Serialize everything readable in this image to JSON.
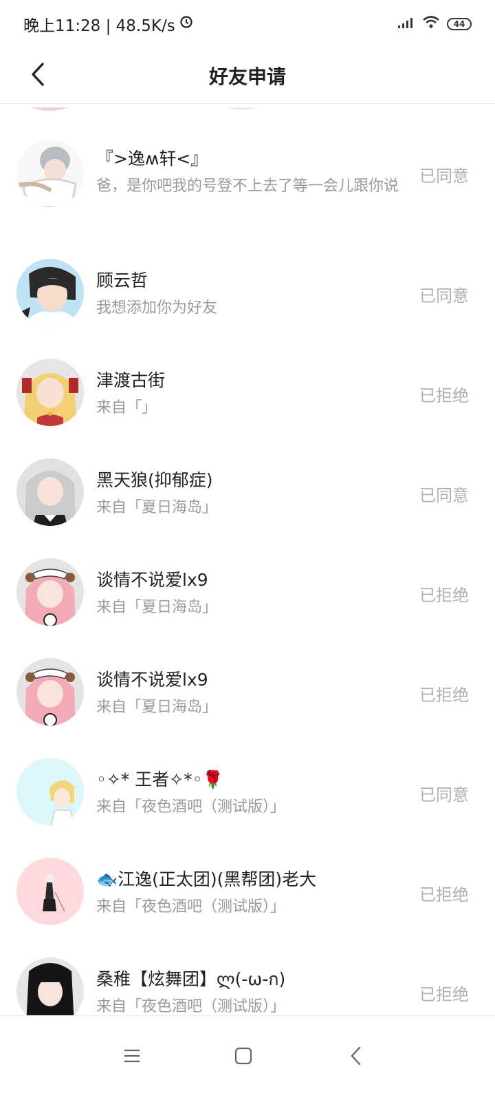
{
  "status_bar": {
    "time_speed": "晚上11:28 | 48.5K/s",
    "battery": "44"
  },
  "header": {
    "title": "好友申请"
  },
  "requests": [
    {
      "name": "『>逸ʍ轩<』",
      "message": "爸，是你吧我的号登不上去了等一会儿跟你说",
      "status": "已同意"
    },
    {
      "name": "顾云哲",
      "message": "我想添加你为好友",
      "status": "已同意"
    },
    {
      "name": "津渡古街",
      "message": "来自「」",
      "status": "已拒绝"
    },
    {
      "name": "黑天狼(抑郁症)",
      "message": "来自「夏日海岛」",
      "status": "已同意"
    },
    {
      "name": "谈情不说爱lx9",
      "message": "来自「夏日海岛」",
      "status": "已拒绝"
    },
    {
      "name": "谈情不说爱lx9",
      "message": "来自「夏日海岛」",
      "status": "已拒绝"
    },
    {
      "name": "◦✧* 王者✧*◦🌹",
      "message": "来自「夜色酒吧（测试版）」",
      "status": "已同意"
    },
    {
      "name": "🐟江逸(正太团)(黑帮团)老大",
      "message": "来自「夜色酒吧（测试版）」",
      "status": "已拒绝"
    },
    {
      "name": "桑稚【炫舞团】ლ(-ω-ก)",
      "message": "来自「夜色酒吧（测试版）」",
      "status": "已拒绝"
    }
  ],
  "icons": {
    "back": "chevron-left-icon",
    "signal": "signal-icon",
    "wifi": "wifi-icon",
    "clock": "alarm-icon",
    "menu": "menu-icon",
    "home": "home-icon",
    "nav_back": "back-icon"
  },
  "colors": {
    "status_text": "#b0b0b0",
    "message_text": "#9b9b9b"
  }
}
